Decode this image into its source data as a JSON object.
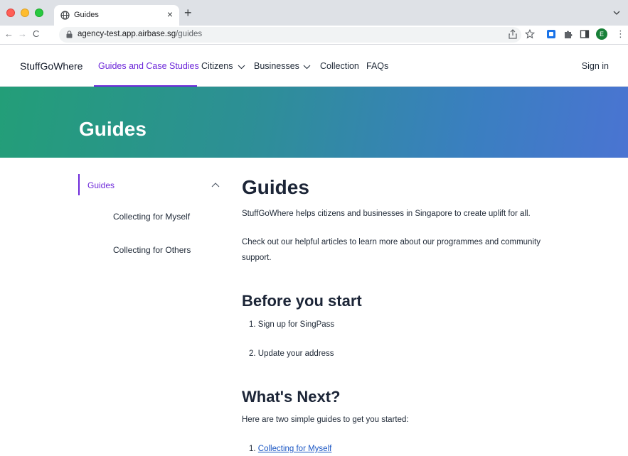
{
  "browser": {
    "tab_title": "Guides",
    "tab_close": "×",
    "new_tab": "+",
    "url_host": "agency-test.app.airbase.sg",
    "url_path": "/guides",
    "nav_back": "←",
    "nav_forward": "→",
    "nav_reload": "C",
    "profile_initial": "E",
    "menu": "⋮",
    "icons": [
      "globe-icon",
      "lock-icon",
      "share-icon",
      "star-icon",
      "extension-app-icon",
      "puzzle-icon",
      "sidepanel-icon",
      "profile-avatar"
    ]
  },
  "header": {
    "brand": "StuffGoWhere",
    "nav": [
      {
        "label": "Guides and Case Studies",
        "active": true
      },
      {
        "label": "Citizens",
        "dropdown": true
      },
      {
        "label": "Businesses",
        "dropdown": true
      },
      {
        "label": "Collection"
      },
      {
        "label": "FAQs"
      }
    ],
    "sign_in": "Sign in"
  },
  "hero": {
    "title": "Guides"
  },
  "sidebar": {
    "section": "Guides",
    "expanded": true,
    "items": [
      "Collecting for Myself",
      "Collecting for Others"
    ]
  },
  "main": {
    "title": "Guides",
    "intro": "StuffGoWhere helps citizens and businesses in Singapore to create uplift for all.",
    "intro2": "Check out our helpful articles to learn more about our programmes and community support.",
    "before_title": "Before you start",
    "before_steps": [
      "1. Sign up for SingPass",
      "2. Update your address"
    ],
    "next_title": "What's Next?",
    "next_intro": "Here are two simple guides to get you started:",
    "next_prefix": "1. ",
    "next_link": "Collecting for Myself"
  },
  "colors": {
    "accent": "#6d28d9",
    "hero_start": "#239e78",
    "hero_end": "#4a74d2",
    "link": "#1a56c4",
    "heading": "#1c2537"
  }
}
